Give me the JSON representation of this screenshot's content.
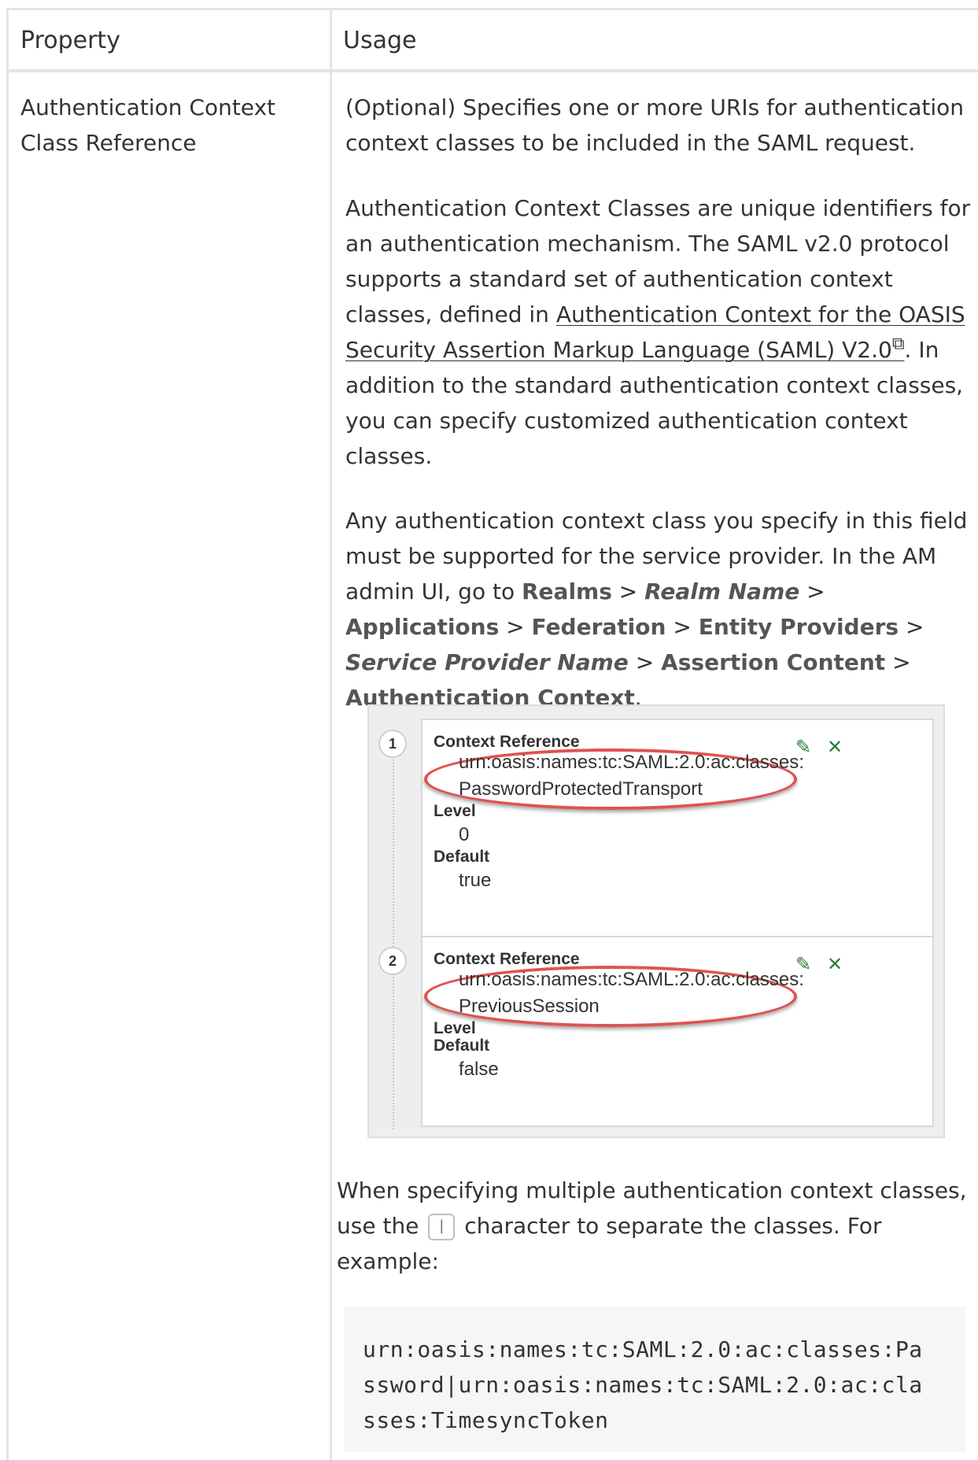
{
  "table": {
    "headers": {
      "property": "Property",
      "usage": "Usage"
    },
    "row": {
      "property_name": "Authentication Context Class Reference",
      "usage": {
        "p1": "(Optional) Specifies one or more URIs for authentication context classes to be included in the SAML request.",
        "p2_before_link": "Authentication Context Classes are unique identifiers for an authentication mechanism. The SAML v2.0 protocol supports a standard set of authentication context classes, defined in ",
        "p2_link": "Authentication Context for the OASIS Security Assertion Markup Language (SAML) V2.0",
        "p2_link_icon": "external-link-icon",
        "p2_after_link": ". In addition to the standard authentication context classes, you can specify customized authentication context classes.",
        "p3_intro": "Any authentication context class you specify in this field must be supported for the service provider. In the AM admin UI, go to ",
        "p3_nav": {
          "realms": "Realms",
          "realm_name": "Realm Name",
          "applications": "Applications",
          "federation": "Federation",
          "entity_providers": "Entity Providers",
          "service_provider_name": "Service Provider Name",
          "assertion_content": "Assertion Content",
          "authentication_context": "Authentication Context",
          "separator": ">"
        },
        "figure": {
          "entries": [
            {
              "index": "1",
              "context_reference_label": "Context Reference",
              "context_reference_line1": "urn:oasis:names:tc:SAML:2.0:ac:classes:",
              "context_reference_line2": "PasswordProtectedTransport",
              "level_label": "Level",
              "level_value": "0",
              "default_label": "Default",
              "default_value": "true"
            },
            {
              "index": "2",
              "context_reference_label": "Context Reference",
              "context_reference_line1": "urn:oasis:names:tc:SAML:2.0:ac:classes:",
              "context_reference_line2": "PreviousSession",
              "level_label": "Level",
              "default_label": "Default",
              "default_value": "false"
            }
          ],
          "highlight_color": "#e0524f",
          "action_color": "#2c7d33"
        },
        "p4_before": "When specifying multiple authentication context classes, use the ",
        "p4_separator_char": "|",
        "p4_after": " character to separate the classes. For example:",
        "code_lines": [
          "urn:oasis:names:tc:SAML:2.0:ac:classes:Pa",
          "ssword|urn:oasis:names:tc:SAML:2.0:ac:cla",
          "sses:TimesyncToken"
        ]
      }
    }
  }
}
